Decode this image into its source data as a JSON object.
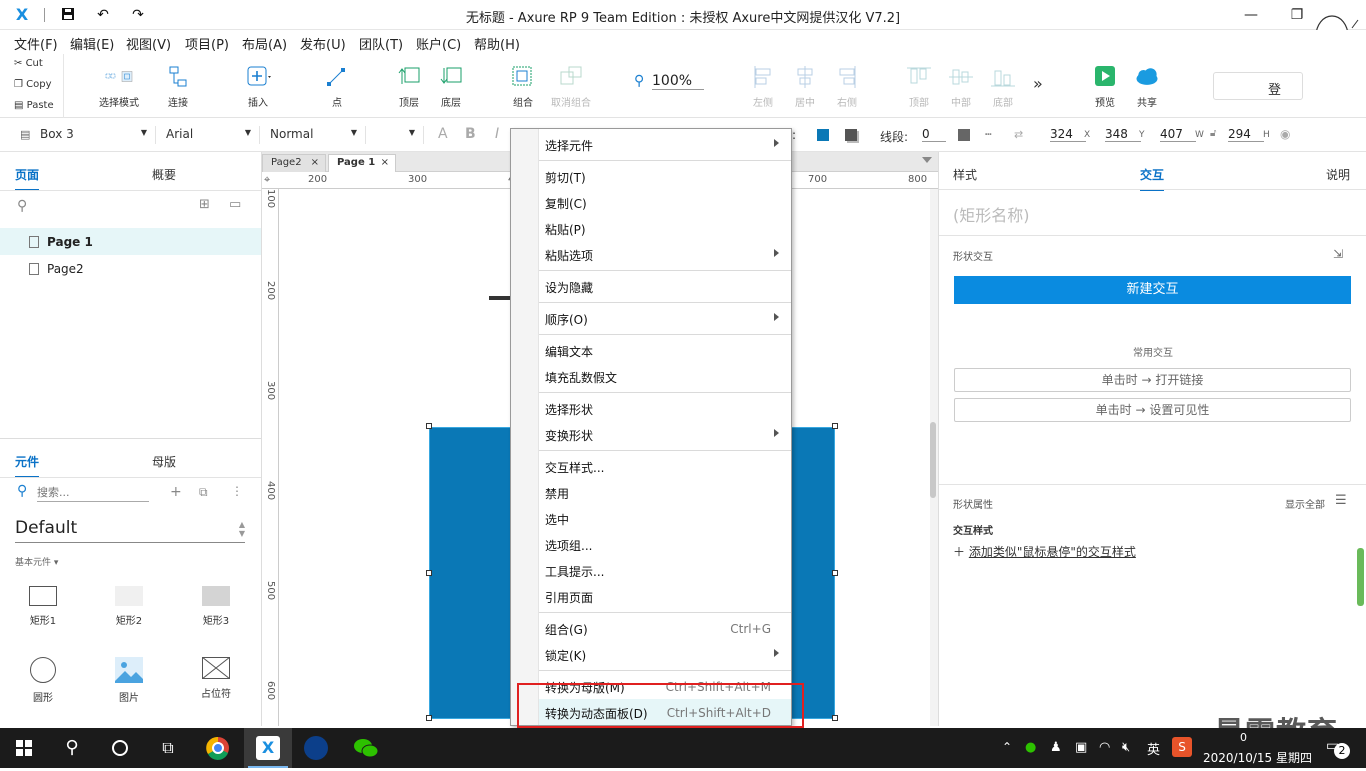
{
  "window": {
    "title": "无标题 - Axure RP 9 Team Edition : 未授权     Axure中文网提供汉化 V7.2]",
    "logo": "X"
  },
  "menubar": [
    "文件(F)",
    "编辑(E)",
    "视图(V)",
    "项目(P)",
    "布局(A)",
    "发布(U)",
    "团队(T)",
    "账户(C)",
    "帮助(H)"
  ],
  "clipboard": {
    "cut": "Cut",
    "copy": "Copy",
    "paste": "Paste"
  },
  "toolbar": {
    "select_mode": "选择模式",
    "connect": "连接",
    "insert": "插入",
    "point": "点",
    "top_layer": "顶层",
    "bottom_layer": "底层",
    "group": "组合",
    "ungroup": "取消组合",
    "zoom": "100%",
    "left": "左侧",
    "center": "居中",
    "right": "右侧",
    "top": "顶部",
    "middle": "中部",
    "bottom": "底部",
    "more": "»",
    "preview": "预览",
    "share": "共享",
    "login": "登"
  },
  "formatbar": {
    "style_name": "Box 3",
    "font": "Arial",
    "font_style": "Normal",
    "bold": "B",
    "italic": "I",
    "fill_label": ":",
    "line_label": "线段:",
    "line_value": "0",
    "x": "324",
    "x_label": "X",
    "y": "348",
    "y_label": "Y",
    "w": "407",
    "w_label": "W",
    "h": "294",
    "h_label": "H"
  },
  "left_panel": {
    "tabs": [
      "页面",
      "概要"
    ],
    "pages": [
      "Page 1",
      "Page2"
    ],
    "lib_tabs": [
      "元件",
      "母版"
    ],
    "search_placeholder": "搜索...",
    "library": "Default",
    "category": "基本元件 ▾",
    "widgets": [
      "矩形1",
      "矩形2",
      "矩形3",
      "圆形",
      "图片",
      "占位符"
    ]
  },
  "canvas": {
    "tabs": [
      "Page2",
      "Page 1"
    ],
    "ruler_h": [
      "200",
      "300",
      "400",
      "500",
      "600",
      "700",
      "800"
    ],
    "ruler_v": [
      "100",
      "200",
      "300",
      "400",
      "500",
      "600"
    ],
    "shape_color": "#0a78b6"
  },
  "context_menu": {
    "items": [
      {
        "label": "选择元件",
        "shortcut": "",
        "sub": true
      },
      {
        "label": "剪切(T)",
        "shortcut": "",
        "sub": false
      },
      {
        "label": "复制(C)",
        "shortcut": "",
        "sub": false
      },
      {
        "label": "粘贴(P)",
        "shortcut": "",
        "sub": false
      },
      {
        "label": "粘贴选项",
        "shortcut": "",
        "sub": true
      },
      {
        "label": "设为隐藏",
        "shortcut": "",
        "sub": false
      },
      {
        "label": "顺序(O)",
        "shortcut": "",
        "sub": true
      },
      {
        "label": "编辑文本",
        "shortcut": "",
        "sub": false
      },
      {
        "label": "填充乱数假文",
        "shortcut": "",
        "sub": false
      },
      {
        "label": "选择形状",
        "shortcut": "",
        "sub": false
      },
      {
        "label": "变换形状",
        "shortcut": "",
        "sub": true
      },
      {
        "label": "交互样式...",
        "shortcut": "",
        "sub": false
      },
      {
        "label": "禁用",
        "shortcut": "",
        "sub": false
      },
      {
        "label": "选中",
        "shortcut": "",
        "sub": false
      },
      {
        "label": "选项组...",
        "shortcut": "",
        "sub": false
      },
      {
        "label": "工具提示...",
        "shortcut": "",
        "sub": false
      },
      {
        "label": "引用页面",
        "shortcut": "",
        "sub": false
      },
      {
        "label": "组合(G)",
        "shortcut": "Ctrl+G",
        "sub": false
      },
      {
        "label": "锁定(K)",
        "shortcut": "",
        "sub": true
      },
      {
        "label": "转换为母版(M)",
        "shortcut": "Ctrl+Shift+Alt+M",
        "sub": false
      },
      {
        "label": "转换为动态面板(D)",
        "shortcut": "Ctrl+Shift+Alt+D",
        "sub": false
      }
    ],
    "highlight_color": "#e02020"
  },
  "right_panel": {
    "tabs": [
      "样式",
      "交互",
      "说明"
    ],
    "shape_name_placeholder": "(矩形名称)",
    "shape_interaction": "形状交互",
    "new_interaction": "新建交互",
    "common": "常用交互",
    "common_items": [
      "单击时 → 打开链接",
      "单击时 → 设置可见性"
    ],
    "shape_props": "形状属性",
    "show_all": "显示全部",
    "interaction_style": "交互样式",
    "add_style": "添加类似\"鼠标悬停\"的交互样式",
    "accent": "#0a8be0"
  },
  "taskbar": {
    "ime": "英",
    "datetime": "2020/10/15 星期四",
    "notif_count": "2",
    "tray_time_fragment": "0"
  },
  "watermark": "最需教育"
}
